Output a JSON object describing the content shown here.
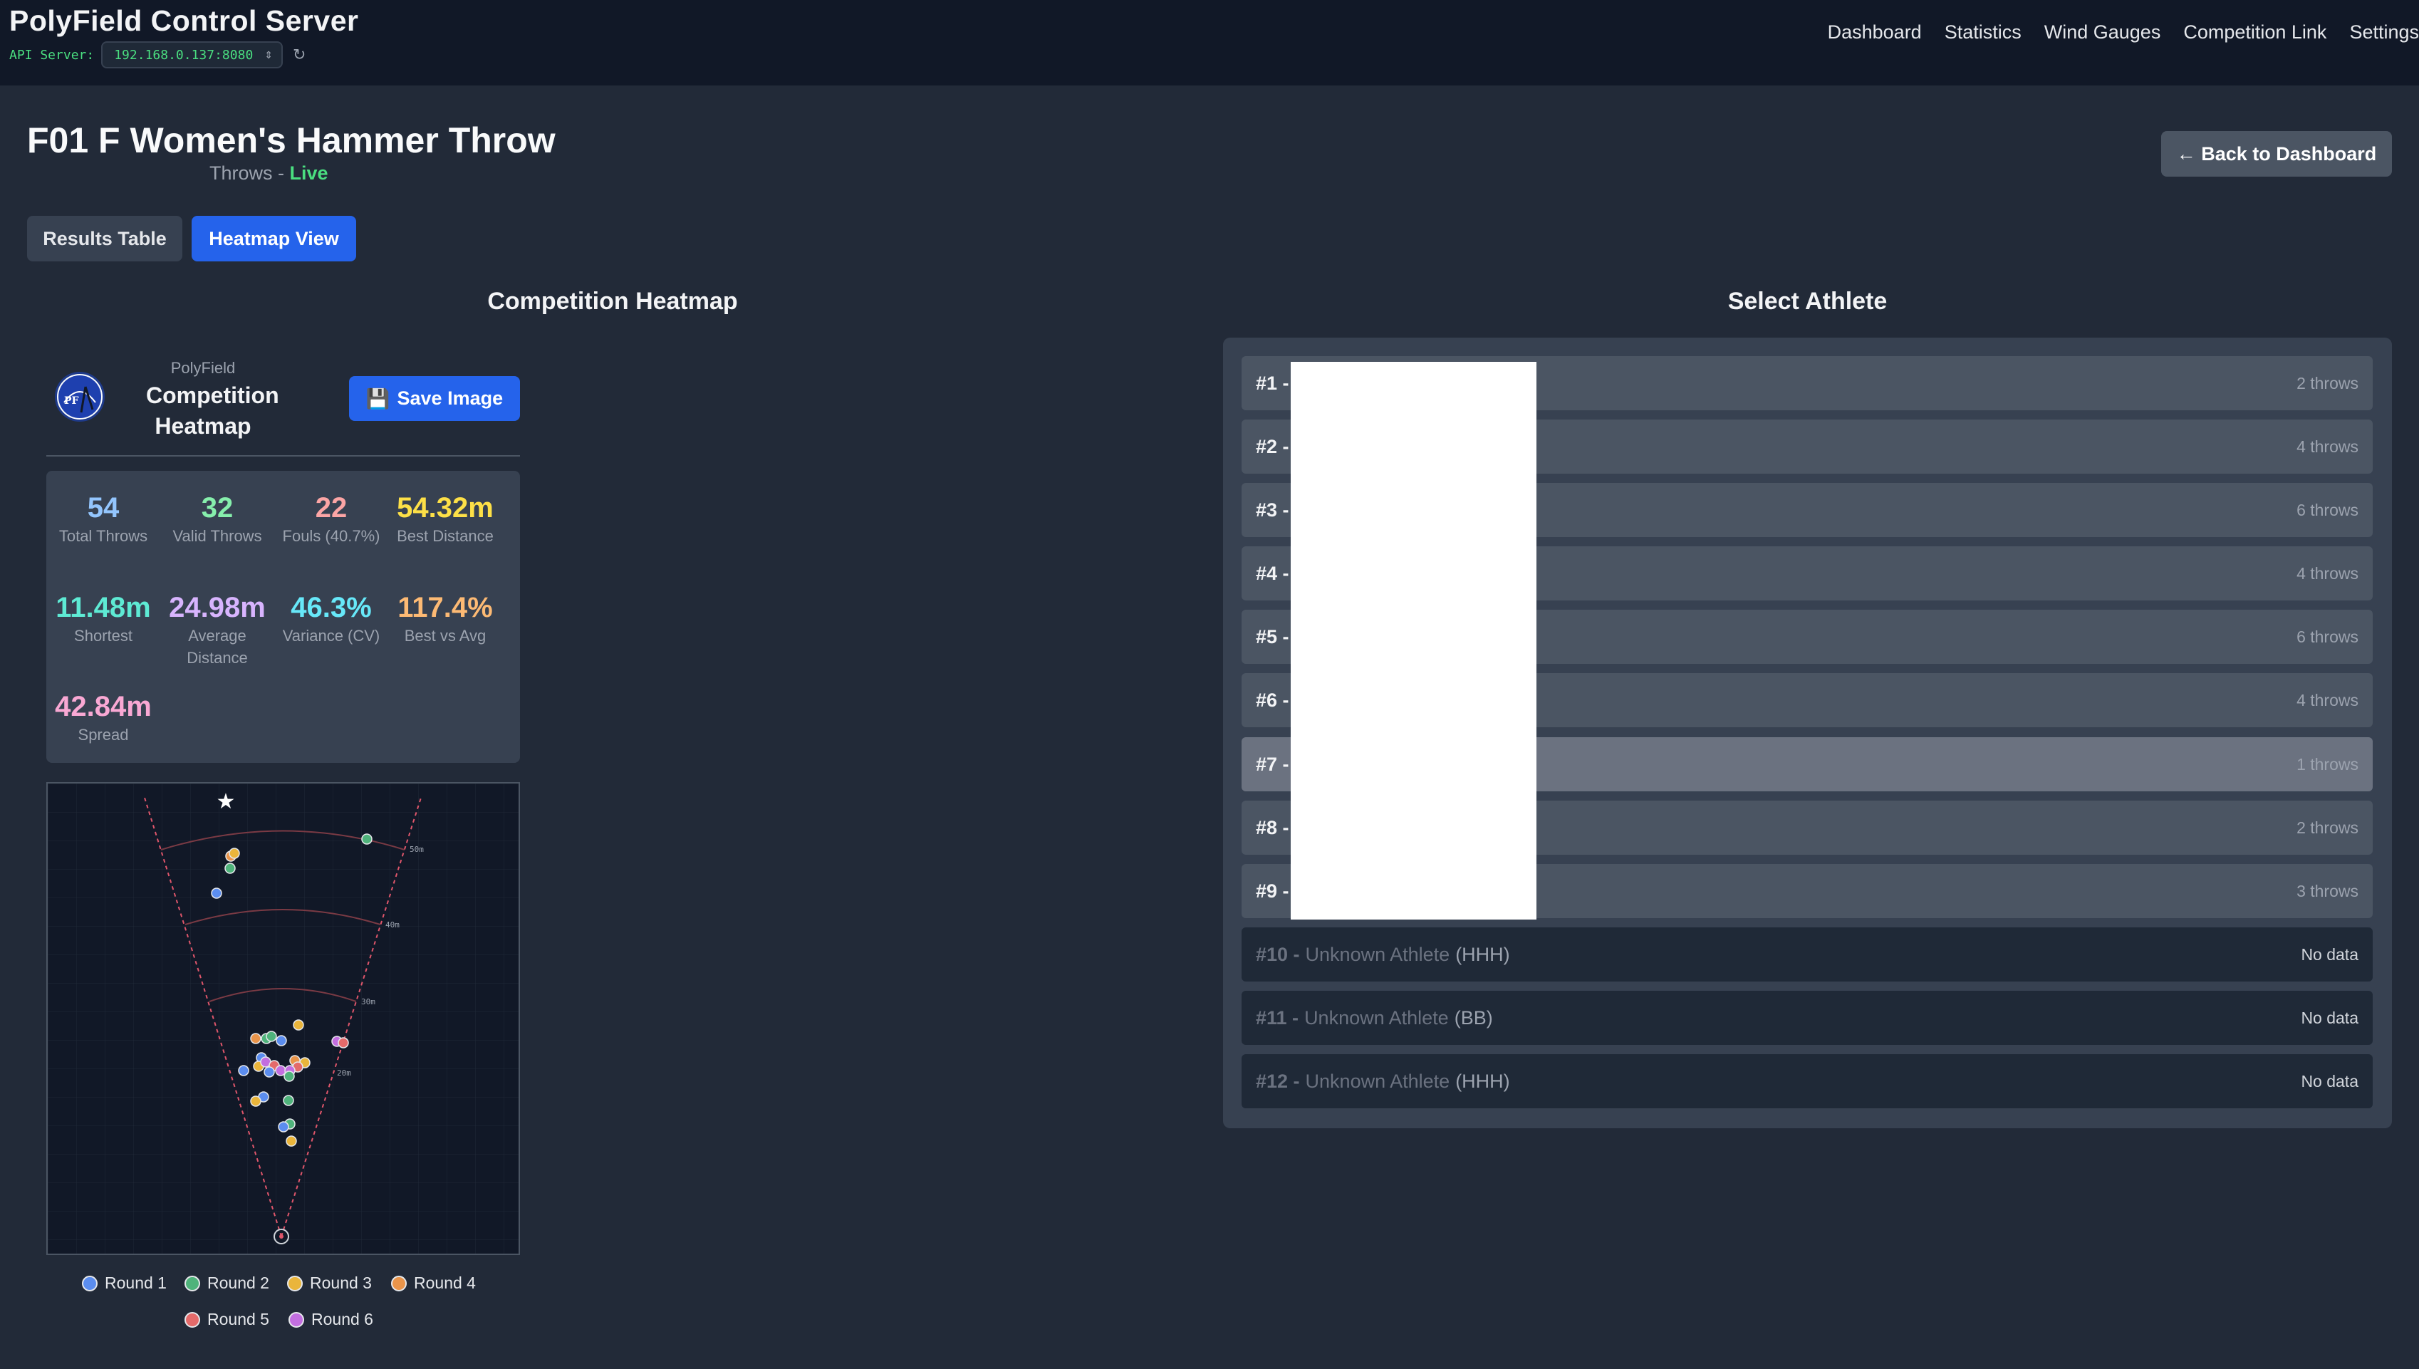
{
  "header": {
    "app_title": "PolyField Control Server",
    "api_label": "API Server:",
    "api_server": "192.168.0.137:8080",
    "nav": [
      "Dashboard",
      "Statistics",
      "Wind Gauges",
      "Competition Link",
      "Settings"
    ]
  },
  "event": {
    "title": "F01 F Women's Hammer Throw",
    "category": "Throws",
    "separator": "-",
    "status": "Live",
    "back_label": "← Back to Dashboard"
  },
  "tabs": {
    "results": "Results Table",
    "heatmap": "Heatmap View",
    "active": "heatmap"
  },
  "heatmap_section": {
    "title": "Competition Heatmap",
    "brand_small": "PolyField",
    "brand_line1": "Competition",
    "brand_line2": "Heatmap",
    "save_label": "Save Image"
  },
  "stats": [
    {
      "value": "54",
      "label": "Total Throws",
      "color": "#93c5fd"
    },
    {
      "value": "32",
      "label": "Valid Throws",
      "color": "#86efac"
    },
    {
      "value": "22",
      "label": "Fouls (40.7%)",
      "color": "#fca5a5"
    },
    {
      "value": "54.32m",
      "label": "Best Distance",
      "color": "#fde047"
    },
    {
      "value": "11.48m",
      "label": "Shortest",
      "color": "#5eead4"
    },
    {
      "value": "24.98m",
      "label": "Average Distance",
      "color": "#d8b4fe"
    },
    {
      "value": "46.3%",
      "label": "Variance (CV)",
      "color": "#67e8f9"
    },
    {
      "value": "117.4%",
      "label": "Best vs Avg",
      "color": "#fdba74"
    },
    {
      "value": "42.84m",
      "label": "Spread",
      "color": "#f9a8d4"
    }
  ],
  "heatmap": {
    "arc_labels": [
      "50m",
      "40m",
      "30m",
      "20m"
    ],
    "legend": [
      {
        "label": "Round 1",
        "color": "#5b8def"
      },
      {
        "label": "Round 2",
        "color": "#4fb37b"
      },
      {
        "label": "Round 3",
        "color": "#eab53b"
      },
      {
        "label": "Round 4",
        "color": "#e9944a"
      },
      {
        "label": "Round 5",
        "color": "#e46a6a"
      },
      {
        "label": "Round 6",
        "color": "#c36ee0"
      }
    ]
  },
  "athlete_section": {
    "title": "Select Athlete",
    "athletes": [
      {
        "num": "#1 -",
        "name": "",
        "team": "",
        "throws": "2 throws",
        "state": "has-data"
      },
      {
        "num": "#2 -",
        "name": "",
        "team": "",
        "throws": "4 throws",
        "state": "has-data"
      },
      {
        "num": "#3 -",
        "name": "",
        "team": "",
        "throws": "6 throws",
        "state": "has-data"
      },
      {
        "num": "#4 -",
        "name": "",
        "team": "",
        "throws": "4 throws",
        "state": "has-data"
      },
      {
        "num": "#5 -",
        "name": "",
        "team": "",
        "throws": "6 throws",
        "state": "has-data"
      },
      {
        "num": "#6 -",
        "name": "",
        "team": "",
        "throws": "4 throws",
        "state": "has-data"
      },
      {
        "num": "#7 -",
        "name": "",
        "team": "",
        "throws": "1 throws",
        "state": "selected"
      },
      {
        "num": "#8 -",
        "name": "",
        "team": "",
        "throws": "2 throws",
        "state": "has-data"
      },
      {
        "num": "#9 -",
        "name": "",
        "team": "",
        "throws": "3 throws",
        "state": "has-data"
      },
      {
        "num": "#10 -",
        "name": "Unknown Athlete",
        "team": "(HHH)",
        "throws": "No data",
        "state": "no-data"
      },
      {
        "num": "#11 -",
        "name": "Unknown Athlete",
        "team": "(BB)",
        "throws": "No data",
        "state": "no-data"
      },
      {
        "num": "#12 -",
        "name": "Unknown Athlete",
        "team": "(HHH)",
        "throws": "No data",
        "state": "no-data"
      }
    ]
  }
}
